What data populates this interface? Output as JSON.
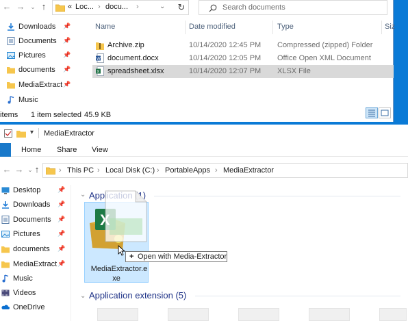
{
  "top_window": {
    "breadcrumb": [
      "«",
      "Loc...",
      "docu..."
    ],
    "search_placeholder": "Search documents",
    "sidebar": [
      {
        "label": "Downloads",
        "icon": "download-arrow-icon"
      },
      {
        "label": "Documents",
        "icon": "documents-icon"
      },
      {
        "label": "Pictures",
        "icon": "pictures-icon"
      },
      {
        "label": "documents",
        "icon": "folder-icon"
      },
      {
        "label": "MediaExtract",
        "icon": "folder-icon"
      },
      {
        "label": "Music",
        "icon": "music-icon"
      }
    ],
    "columns": {
      "name": "Name",
      "date": "Date modified",
      "type": "Type",
      "size": "Siz"
    },
    "files": [
      {
        "name": "Archive.zip",
        "date": "10/14/2020 12:45 PM",
        "type": "Compressed (zipped) Folder",
        "icon": "zip-icon",
        "selected": false
      },
      {
        "name": "document.docx",
        "date": "10/14/2020 12:05 PM",
        "type": "Office Open XML Document",
        "icon": "word-doc-icon",
        "selected": false
      },
      {
        "name": "spreadsheet.xlsx",
        "date": "10/14/2020 12:07 PM",
        "type": "XLSX File",
        "icon": "excel-file-icon",
        "selected": true
      }
    ],
    "status": {
      "count": "items",
      "selected": "1 item selected",
      "size": "45.9 KB"
    }
  },
  "bottom_window": {
    "title": "MediaExtractor",
    "ribbon_tabs": [
      "Home",
      "Share",
      "View"
    ],
    "path": [
      "This PC",
      "Local Disk (C:)",
      "PortableApps",
      "MediaExtractor"
    ],
    "sidebar": [
      {
        "label": "Desktop",
        "icon": "desktop-icon"
      },
      {
        "label": "Downloads",
        "icon": "download-arrow-icon"
      },
      {
        "label": "Documents",
        "icon": "documents-icon"
      },
      {
        "label": "Pictures",
        "icon": "pictures-icon"
      },
      {
        "label": "documents",
        "icon": "folder-icon"
      },
      {
        "label": "MediaExtract",
        "icon": "folder-icon"
      },
      {
        "label": "Music",
        "icon": "music-icon"
      },
      {
        "label": "Videos",
        "icon": "videos-icon"
      },
      {
        "label": "OneDrive",
        "icon": "onedrive-icon"
      }
    ],
    "groups": [
      {
        "label": "Application (1)"
      },
      {
        "label": "Application extension (5)"
      }
    ],
    "tile_label_line1": "MediaExtractor.e",
    "tile_label_line2": "xe",
    "drag_tooltip": "Open with Media-Extractor",
    "drag_tooltip_symbol": "+"
  }
}
